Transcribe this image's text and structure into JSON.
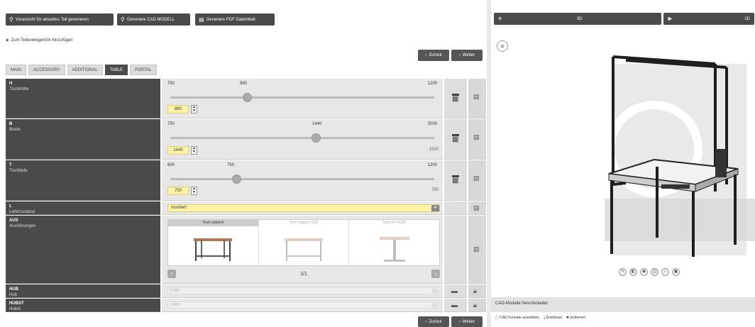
{
  "toolbar": {
    "btn1": "Voransicht für aktuelles Teil generieren",
    "btn2": "Generiere CAD MODELL",
    "btn3": "Generiere PDF Datenblatt"
  },
  "add_link": "Zum Teileviewgericht hinzufügen",
  "nav": {
    "back": "Zurück",
    "next": "Weiter"
  },
  "tabs": [
    "MAIN",
    "ACCESSORY",
    "ADDITIONAL",
    "TABLE",
    "PORTAL"
  ],
  "active_tab": "TABLE",
  "rows": {
    "h": {
      "code": "H",
      "label": "Tischhöhe",
      "min": "750",
      "max": "1200",
      "marker": "880",
      "value": "880",
      "fraction": 0.29
    },
    "b": {
      "code": "B",
      "label": "Breite",
      "min": "750",
      "max": "2000",
      "marker": "1440",
      "value": "1440",
      "range_val": "1500",
      "fraction": 0.55
    },
    "t": {
      "code": "T",
      "label": "Tischtiefe",
      "min": "600",
      "max": "1200",
      "marker": "750",
      "value": "750",
      "range_val": "750",
      "fraction": 0.25
    },
    "l": {
      "code": "L",
      "label": "Lieferzustand",
      "value": "montiert"
    },
    "ausf": {
      "code": "AUS",
      "label": "Ausführungen",
      "options": [
        "Tisch statisch",
        "Tisch statisch ESD",
        "Tisch H-V ESD"
      ],
      "page": "1/1"
    },
    "hub": {
      "code": "HUB",
      "label": "Hub",
      "value": "0.000"
    },
    "hubst": {
      "code": "HUBST",
      "label": "Hubst.",
      "value": "0.000"
    }
  },
  "right": {
    "tab1": "3D",
    "tab2": "2D",
    "bottom_title": "CAD-Modelle herunterladen",
    "links": [
      "CAD Formate auswählen",
      "Download",
      "Entfernen"
    ]
  },
  "colors": {
    "yellow": "#fdf3a6",
    "dark": "#4a4a4a"
  },
  "icons": [
    "pencil-icon",
    "cube-icon",
    "eye-icon",
    "ruler-icon",
    "circle-icon",
    "box-icon"
  ]
}
